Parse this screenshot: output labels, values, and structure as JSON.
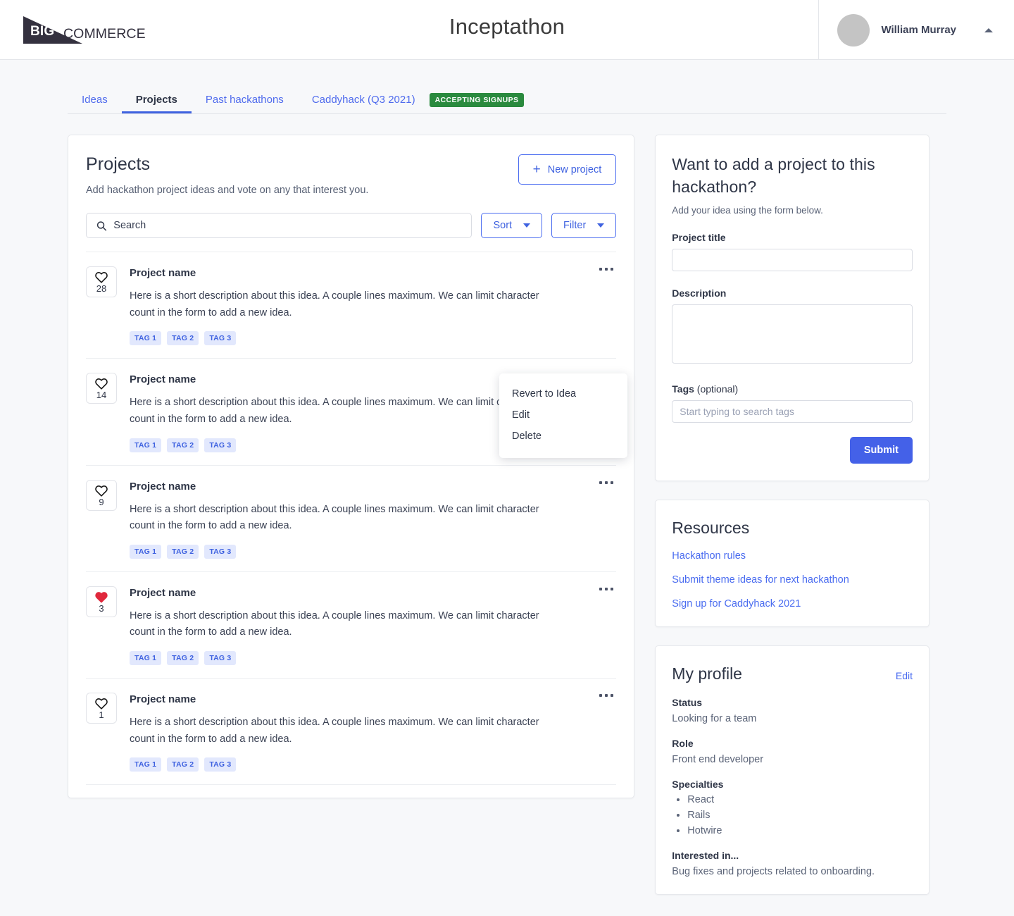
{
  "header": {
    "logo_big": "BIG",
    "logo_commerce": "COMMERCE",
    "app_title": "Inceptathon",
    "user_name": "William Murray",
    "accent_blue": "#3f62e0",
    "badge_green": "#2a8a3e"
  },
  "tabs": [
    {
      "label": "Ideas",
      "active": false
    },
    {
      "label": "Projects",
      "active": true
    },
    {
      "label": "Past hackathons",
      "active": false
    },
    {
      "label": "Caddyhack (Q3 2021)",
      "active": false
    }
  ],
  "tab_badge": "ACCEPTING SIGNUPS",
  "projects": {
    "title": "Projects",
    "subtitle": "Add hackathon project ideas and vote on any that interest you.",
    "new_button": "New project",
    "search_placeholder": "Search",
    "sort_label": "Sort",
    "filter_label": "Filter",
    "rows": [
      {
        "name": "Project name",
        "votes": "28",
        "voted": false,
        "description": "Here is a short description about this idea. A couple lines maximum. We can limit character count in the form to add a new idea.",
        "tags": [
          "TAG 1",
          "TAG 2",
          "TAG 3"
        ]
      },
      {
        "name": "Project name",
        "votes": "14",
        "voted": false,
        "description": "Here is a short description about this idea. A couple lines maximum. We can limit character count in the form to add a new idea.",
        "tags": [
          "TAG 1",
          "TAG 2",
          "TAG 3"
        ]
      },
      {
        "name": "Project name",
        "votes": "9",
        "voted": false,
        "description": "Here is a short description about this idea. A couple lines maximum. We can limit character count in the form to add a new idea.",
        "tags": [
          "TAG 1",
          "TAG 2",
          "TAG 3"
        ]
      },
      {
        "name": "Project name",
        "votes": "3",
        "voted": true,
        "description": "Here is a short description about this idea. A couple lines maximum. We can limit character count in the form to add a new idea.",
        "tags": [
          "TAG 1",
          "TAG 2",
          "TAG 3"
        ]
      },
      {
        "name": "Project name",
        "votes": "1",
        "voted": false,
        "description": "Here is a short description about this idea. A couple lines maximum. We can limit character count in the form to add a new idea.",
        "tags": [
          "TAG 1",
          "TAG 2",
          "TAG 3"
        ]
      }
    ]
  },
  "context_menu": {
    "items": [
      "Revert to Idea",
      "Edit",
      "Delete"
    ]
  },
  "add_project": {
    "heading": "Want to add a project to this hackathon?",
    "subtitle": "Add your idea using the form below.",
    "title_label": "Project title",
    "title_value": "",
    "description_label": "Description",
    "description_value": "",
    "tags_label": "Tags",
    "tags_optional": " (optional)",
    "tags_placeholder": "Start typing to search tags",
    "tags_value": "",
    "submit_label": "Submit"
  },
  "resources": {
    "heading": "Resources",
    "links": [
      "Hackathon rules",
      "Submit theme ideas for next hackathon",
      "Sign up for Caddyhack 2021"
    ]
  },
  "profile": {
    "heading": "My profile",
    "edit_label": "Edit",
    "status_label": "Status",
    "status_value": "Looking for a team",
    "role_label": "Role",
    "role_value": "Front end developer",
    "specialties_label": "Specialties",
    "specialties": [
      "React",
      "Rails",
      "Hotwire"
    ],
    "interested_label": "Interested in...",
    "interested_value": "Bug fixes and projects related to onboarding."
  }
}
